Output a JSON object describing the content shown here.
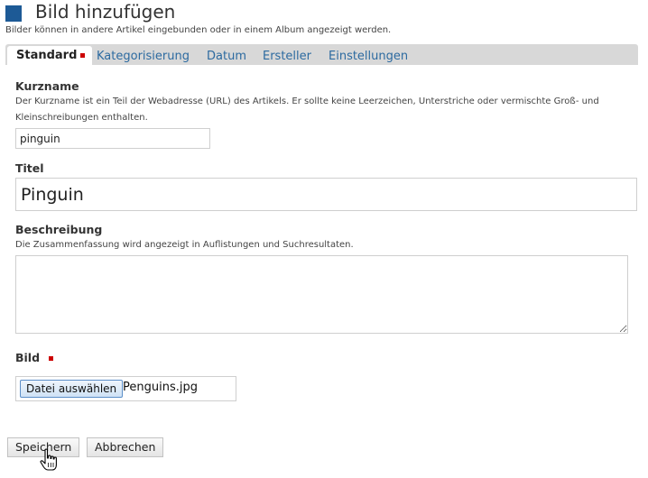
{
  "header": {
    "title": "Bild hinzufügen",
    "description": "Bilder können in andere Artikel eingebunden oder in einem Album angezeigt werden."
  },
  "tabs": [
    {
      "label": "Standard",
      "active": true,
      "required": true
    },
    {
      "label": "Kategorisierung",
      "active": false
    },
    {
      "label": "Datum",
      "active": false
    },
    {
      "label": "Ersteller",
      "active": false
    },
    {
      "label": "Einstellungen",
      "active": false
    }
  ],
  "fields": {
    "kurzname": {
      "label": "Kurzname",
      "help": "Der Kurzname ist ein Teil der Webadresse (URL) des Artikels. Er sollte keine Leerzeichen, Unterstriche oder vermischte Groß- und Kleinschreibungen enthalten.",
      "value": "pinguin"
    },
    "titel": {
      "label": "Titel",
      "value": "Pinguin"
    },
    "beschreibung": {
      "label": "Beschreibung",
      "help": "Die Zusammenfassung wird angezeigt in Auflistungen und Suchresultaten.",
      "value": ""
    },
    "bild": {
      "label": "Bild",
      "required": true,
      "button_label": "Datei auswählen",
      "file_name": "Penguins.jpg"
    }
  },
  "actions": {
    "save_label": "Speichern",
    "cancel_label": "Abbrechen"
  },
  "colors": {
    "accent": "#1d5a96",
    "tab_link": "#2c6aa0",
    "required": "#cc0000"
  }
}
